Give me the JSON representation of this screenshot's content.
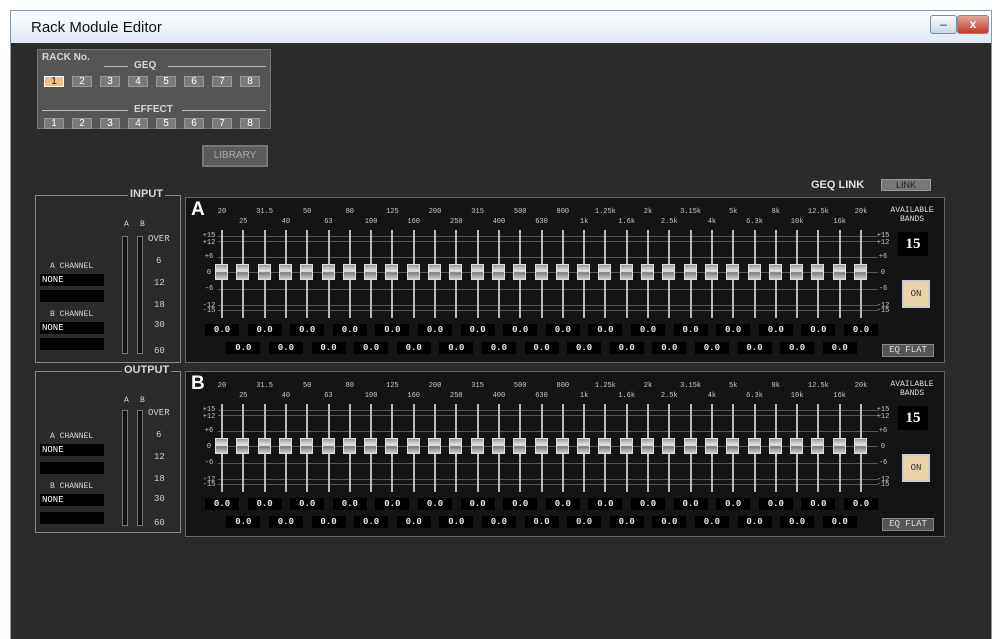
{
  "window": {
    "title": "Rack Module Editor",
    "minimize": "–",
    "close": "x"
  },
  "rack": {
    "title": "RACK No.",
    "geq_label": "GEQ",
    "effect_label": "EFFECT",
    "geq_buttons": [
      "1",
      "2",
      "3",
      "4",
      "5",
      "6",
      "7",
      "8"
    ],
    "effect_buttons": [
      "1",
      "2",
      "3",
      "4",
      "5",
      "6",
      "7",
      "8"
    ],
    "selected_geq": "1"
  },
  "library_label": "LIBRARY",
  "geq_link": {
    "label": "GEQ LINK",
    "button": "LINK"
  },
  "input": {
    "title": "INPUT",
    "meter_a": "A",
    "meter_b": "B",
    "scale": [
      "OVER",
      "6",
      "12",
      "18",
      "30",
      "60"
    ],
    "a_channel_label": "A CHANNEL",
    "a_channel_value": "NONE",
    "b_channel_label": "B CHANNEL",
    "b_channel_value": "NONE"
  },
  "output": {
    "title": "OUTPUT",
    "meter_a": "A",
    "meter_b": "B",
    "scale": [
      "OVER",
      "6",
      "12",
      "18",
      "30",
      "60"
    ],
    "a_channel_label": "A CHANNEL",
    "a_channel_value": "NONE",
    "b_channel_label": "B CHANNEL",
    "b_channel_value": "NONE"
  },
  "geq_panels": [
    {
      "letter": "A",
      "frequencies": [
        "20",
        "25",
        "31.5",
        "40",
        "50",
        "63",
        "80",
        "100",
        "125",
        "160",
        "200",
        "250",
        "315",
        "400",
        "500",
        "630",
        "800",
        "1k",
        "1.25k",
        "1.6k",
        "2k",
        "2.5k",
        "3.15k",
        "4k",
        "5k",
        "6.3k",
        "8k",
        "10k",
        "12.5k",
        "16k",
        "20k"
      ],
      "gain_values": [
        "0.0",
        "0.0",
        "0.0",
        "0.0",
        "0.0",
        "0.0",
        "0.0",
        "0.0",
        "0.0",
        "0.0",
        "0.0",
        "0.0",
        "0.0",
        "0.0",
        "0.0",
        "0.0",
        "0.0",
        "0.0",
        "0.0",
        "0.0",
        "0.0",
        "0.0",
        "0.0",
        "0.0",
        "0.0",
        "0.0",
        "0.0",
        "0.0",
        "0.0",
        "0.0",
        "0.0"
      ],
      "available_bands_label": "AVAILABLE BANDS",
      "available_bands": "15",
      "on_label": "ON",
      "eq_flat_label": "EQ FLAT",
      "db_labels": [
        "+15",
        "+12",
        "+6",
        "0",
        "-6",
        "-12",
        "-15"
      ]
    },
    {
      "letter": "B",
      "frequencies": [
        "20",
        "25",
        "31.5",
        "40",
        "50",
        "63",
        "80",
        "100",
        "125",
        "160",
        "200",
        "250",
        "315",
        "400",
        "500",
        "630",
        "800",
        "1k",
        "1.25k",
        "1.6k",
        "2k",
        "2.5k",
        "3.15k",
        "4k",
        "5k",
        "6.3k",
        "8k",
        "10k",
        "12.5k",
        "16k",
        "20k"
      ],
      "gain_values": [
        "0.0",
        "0.0",
        "0.0",
        "0.0",
        "0.0",
        "0.0",
        "0.0",
        "0.0",
        "0.0",
        "0.0",
        "0.0",
        "0.0",
        "0.0",
        "0.0",
        "0.0",
        "0.0",
        "0.0",
        "0.0",
        "0.0",
        "0.0",
        "0.0",
        "0.0",
        "0.0",
        "0.0",
        "0.0",
        "0.0",
        "0.0",
        "0.0",
        "0.0",
        "0.0",
        "0.0"
      ],
      "available_bands_label": "AVAILABLE BANDS",
      "available_bands": "15",
      "on_label": "ON",
      "eq_flat_label": "EQ FLAT",
      "db_labels": [
        "+15",
        "+12",
        "+6",
        "0",
        "-6",
        "-12",
        "-15"
      ]
    }
  ]
}
